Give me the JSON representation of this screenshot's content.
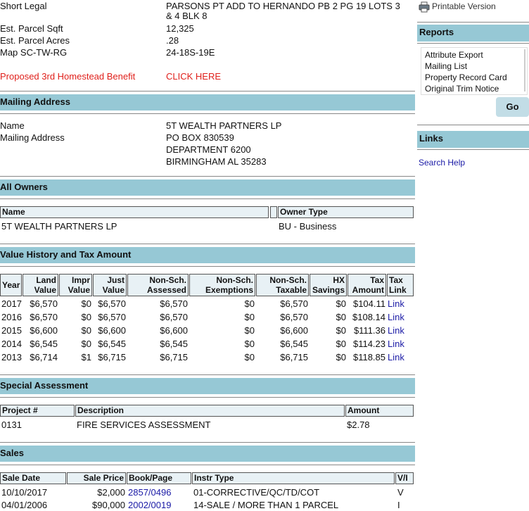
{
  "parcel": {
    "short_legal_label": "Short Legal",
    "short_legal_line1": "PARSONS PT ADD TO HERNANDO PB 2 PG 19 LOTS 3",
    "short_legal_line2": "& 4 BLK 8",
    "sqft_label": "Est. Parcel Sqft",
    "sqft_value": "12,325",
    "acres_label": "Est. Parcel Acres",
    "acres_value": ".28",
    "map_label": "Map SC-TW-RG",
    "map_value": "24-18S-19E",
    "homestead_label": "Proposed 3rd Homestead Benefit",
    "homestead_link": "CLICK HERE"
  },
  "mailing": {
    "title": "Mailing Address",
    "name_label": "Name",
    "name_value": "5T WEALTH PARTNERS LP",
    "address_label": "Mailing Address",
    "address_lines": [
      "PO BOX 830539",
      "DEPARTMENT 6200",
      "BIRMINGHAM AL 35283"
    ]
  },
  "owners": {
    "title": "All Owners",
    "col_name": "Name",
    "col_type": "Owner Type",
    "rows": [
      {
        "name": "5T WEALTH PARTNERS LP",
        "type": "BU - Business"
      }
    ]
  },
  "value_history": {
    "title": "Value History and Tax Amount",
    "headers": {
      "year": "Year",
      "land": [
        "Land",
        "Value"
      ],
      "impr": [
        "Impr",
        "Value"
      ],
      "just": [
        "Just",
        "Value"
      ],
      "nsa": [
        "Non-Sch.",
        "Assessed"
      ],
      "nse": [
        "Non-Sch.",
        "Exemptions"
      ],
      "nst": [
        "Non-Sch.",
        "Taxable"
      ],
      "hx": [
        "HX",
        "Savings"
      ],
      "tax": [
        "Tax",
        "Amount"
      ],
      "link": [
        "Tax",
        "Link"
      ]
    },
    "rows": [
      {
        "year": "2017",
        "land": "$6,570",
        "impr": "$0",
        "just": "$6,570",
        "nsa": "$6,570",
        "nse": "$0",
        "nst": "$6,570",
        "hx": "$0",
        "tax": "$104.11",
        "link": "Link"
      },
      {
        "year": "2016",
        "land": "$6,570",
        "impr": "$0",
        "just": "$6,570",
        "nsa": "$6,570",
        "nse": "$0",
        "nst": "$6,570",
        "hx": "$0",
        "tax": "$108.14",
        "link": "Link"
      },
      {
        "year": "2015",
        "land": "$6,600",
        "impr": "$0",
        "just": "$6,600",
        "nsa": "$6,600",
        "nse": "$0",
        "nst": "$6,600",
        "hx": "$0",
        "tax": "$111.36",
        "link": "Link"
      },
      {
        "year": "2014",
        "land": "$6,545",
        "impr": "$0",
        "just": "$6,545",
        "nsa": "$6,545",
        "nse": "$0",
        "nst": "$6,545",
        "hx": "$0",
        "tax": "$114.23",
        "link": "Link"
      },
      {
        "year": "2013",
        "land": "$6,714",
        "impr": "$1",
        "just": "$6,715",
        "nsa": "$6,715",
        "nse": "$0",
        "nst": "$6,715",
        "hx": "$0",
        "tax": "$118.85",
        "link": "Link"
      }
    ]
  },
  "special": {
    "title": "Special Assessment",
    "col_project": "Project #",
    "col_desc": "Description",
    "col_amount": "Amount",
    "rows": [
      {
        "project": "0131",
        "desc": "FIRE SERVICES ASSESSMENT",
        "amount": "$2.78"
      }
    ]
  },
  "sales": {
    "title": "Sales",
    "col_date": "Sale Date",
    "col_price": "Sale Price",
    "col_book": "Book/Page",
    "col_instr": "Instr Type",
    "col_vi": "V/I",
    "rows": [
      {
        "date": "10/10/2017",
        "price": "$2,000",
        "book": "2857/0496",
        "instr": "01-CORRECTIVE/QC/TD/COT",
        "vi": "V"
      },
      {
        "date": "04/01/2006",
        "price": "$90,000",
        "book": "2002/0019",
        "instr": "14-SALE / MORE THAN 1 PARCEL",
        "vi": "I"
      }
    ]
  },
  "sidebar": {
    "printable": "Printable Version",
    "reports_title": "Reports",
    "reports": [
      "Attribute Export",
      "Mailing List",
      "Property Record Card",
      "Original Trim Notice"
    ],
    "go_label": "Go",
    "links_title": "Links",
    "search_help": "Search Help"
  },
  "colors": {
    "section_bar": "#96c8d5",
    "link": "#1a1aa6",
    "highlight": "#e0201b"
  }
}
